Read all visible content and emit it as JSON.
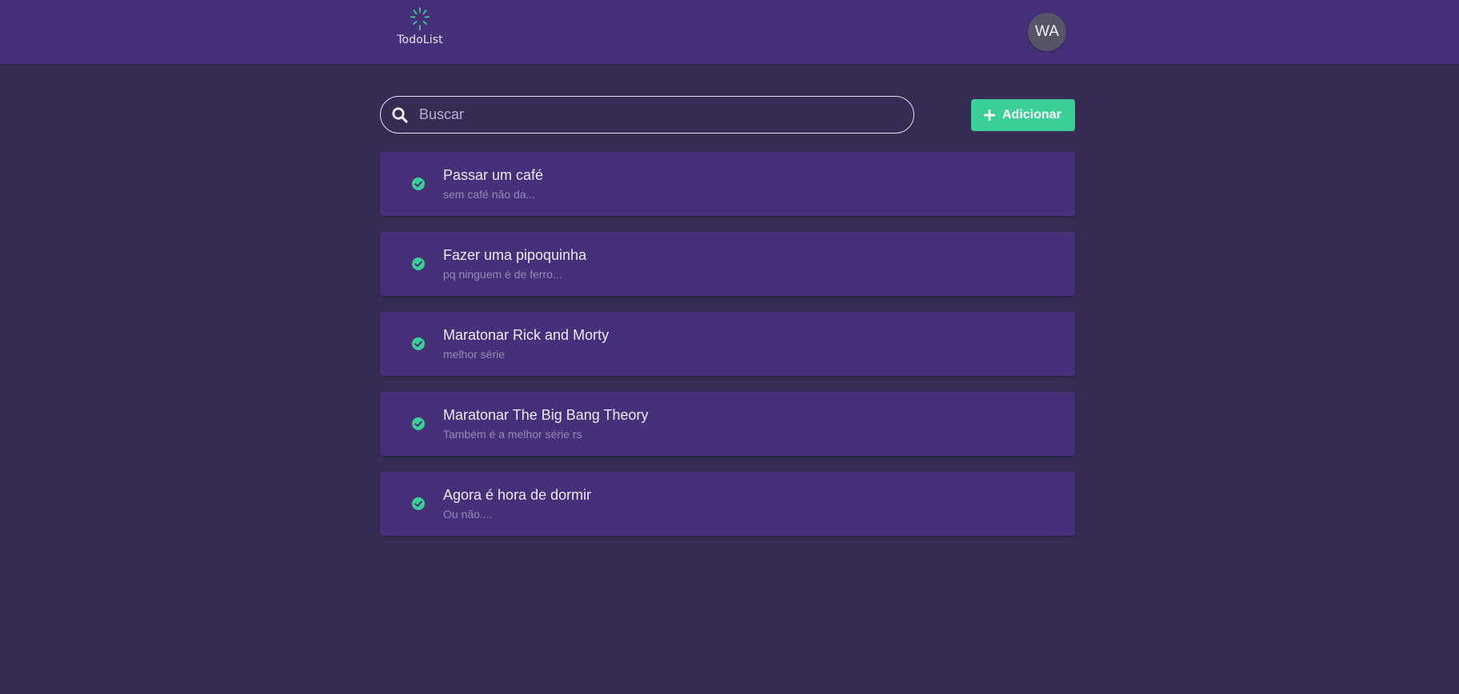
{
  "header": {
    "logo_text": "TodoList",
    "avatar_initials": "WA"
  },
  "search": {
    "placeholder": "Buscar",
    "value": ""
  },
  "toolbar": {
    "add_label": "Adicionar"
  },
  "todos": [
    {
      "title": "Passar um café",
      "description": "sem café não da...",
      "done": true
    },
    {
      "title": "Fazer uma pipoquinha",
      "description": "pq ninguem é de ferro...",
      "done": true
    },
    {
      "title": "Maratonar Rick and Morty",
      "description": "melhor série",
      "done": true
    },
    {
      "title": "Maratonar The Big Bang Theory",
      "description": "Também é a melhor série rs",
      "done": true
    },
    {
      "title": "Agora é hora de dormir",
      "description": "Ou não....",
      "done": true
    }
  ],
  "colors": {
    "background": "#352c54",
    "header": "#46307a",
    "card": "#46307a",
    "accent": "#3bcf97",
    "avatar": "#575466"
  },
  "icons": {
    "logo": "spinner-logo-icon",
    "search": "search-icon",
    "add": "plus-icon",
    "todo_status": "check-circle-icon"
  }
}
